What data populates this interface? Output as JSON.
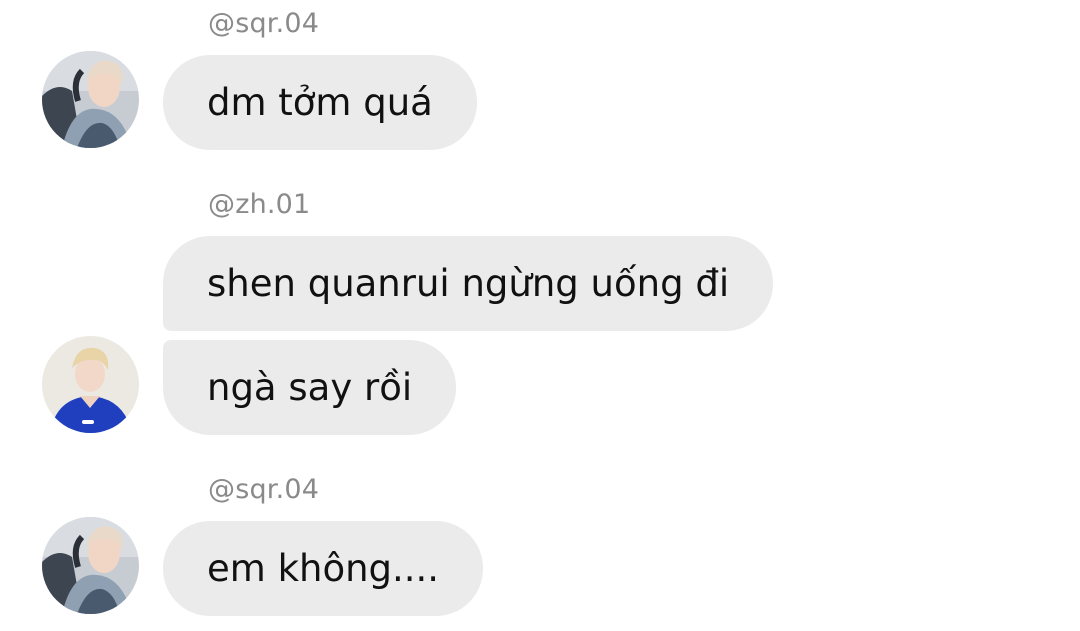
{
  "chat": {
    "groups": [
      {
        "sender": "@sqr.04",
        "avatar_icon": "user-avatar-sqr04",
        "messages": [
          "dm tởm quá"
        ]
      },
      {
        "sender": "@zh.01",
        "avatar_icon": "user-avatar-zh01",
        "messages": [
          "shen quanrui ngừng uống đi",
          "ngà say rồi"
        ]
      },
      {
        "sender": "@sqr.04",
        "avatar_icon": "user-avatar-sqr04",
        "messages": [
          "em không...."
        ]
      }
    ]
  },
  "colors": {
    "bubble_bg": "#ebebeb",
    "sender_text": "#8a8a8a",
    "message_text": "#111111",
    "background": "#ffffff"
  }
}
